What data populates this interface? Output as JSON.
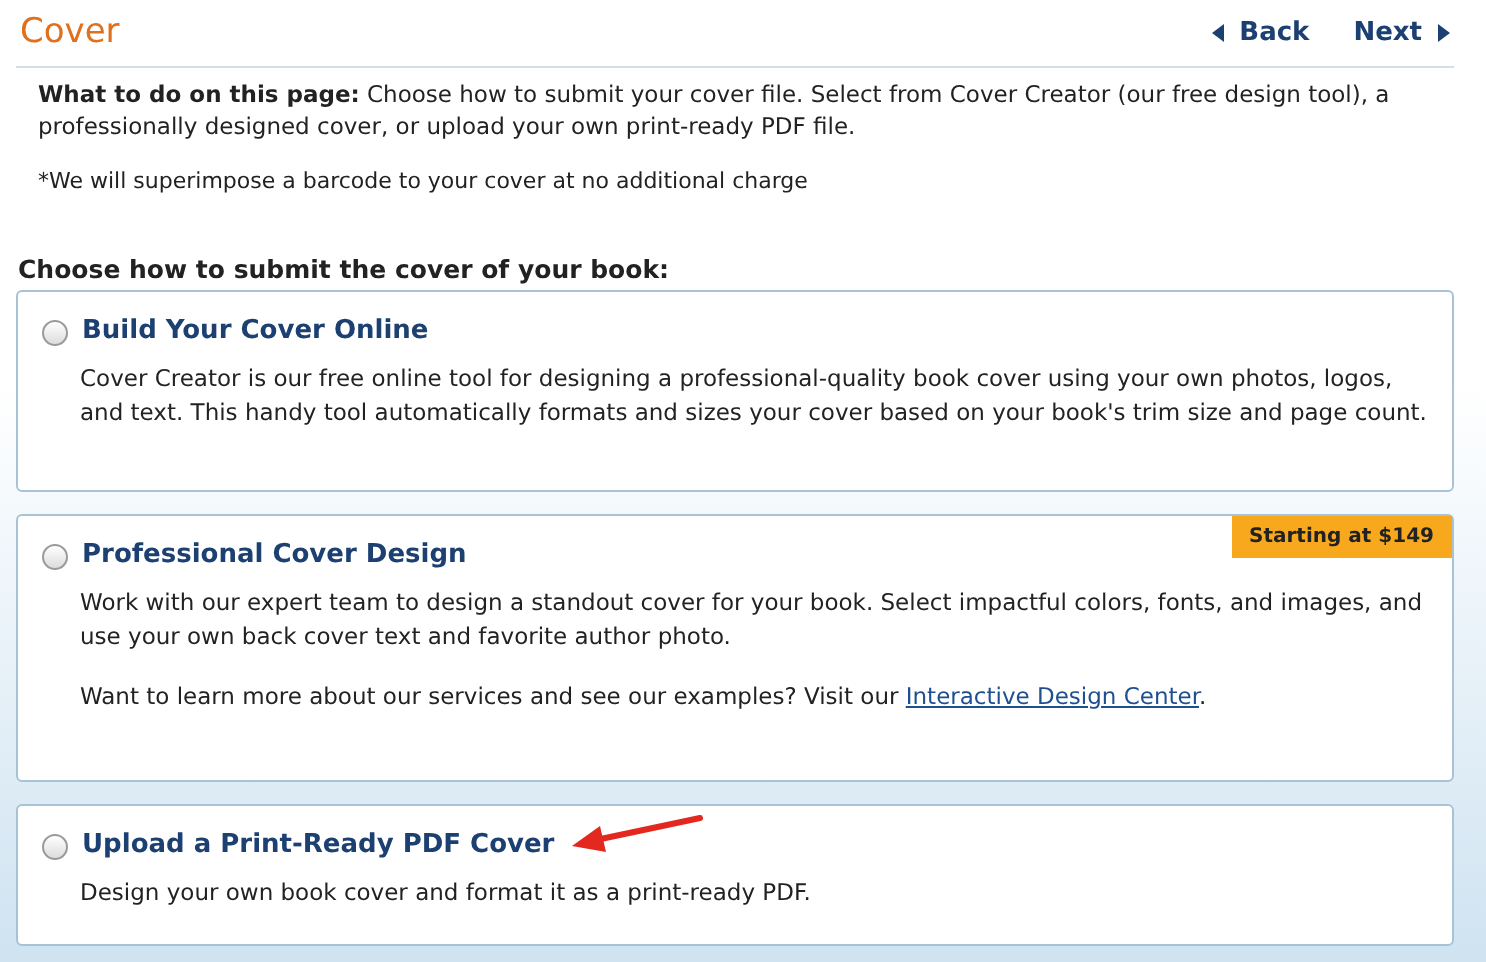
{
  "header": {
    "title": "Cover",
    "back": "Back",
    "next": "Next"
  },
  "intro": {
    "label": "What to do on this page:",
    "text": " Choose how to submit your cover file. Select from Cover Creator (our free design tool), a professionally designed cover, or upload your own print-ready PDF file.",
    "note": "*We will superimpose a barcode to your cover at no additional charge"
  },
  "section_title": "Choose how to submit the cover of your book:",
  "options": [
    {
      "title": "Build Your Cover Online",
      "selected": false,
      "paragraphs": [
        {
          "text": "Cover Creator is our free online tool for designing a professional-quality book cover using your own photos, logos, and text. This handy tool automatically formats and sizes your cover based on your book's trim size and page count."
        }
      ]
    },
    {
      "title": "Professional Cover Design",
      "selected": false,
      "badge": "Starting at $149",
      "paragraphs": [
        {
          "text": "Work with our expert team to design a standout cover for your book. Select impactful colors, fonts, and images, and use your own back cover text and favorite author photo."
        },
        {
          "text": "Want to learn more about our services and see our examples? Visit our ",
          "link": "Interactive Design Center",
          "after": "."
        }
      ]
    },
    {
      "title": "Upload a Print-Ready PDF Cover",
      "selected": false,
      "annotated": true,
      "paragraphs": [
        {
          "text": "Design your own book cover and format it as a print-ready PDF."
        }
      ]
    }
  ]
}
